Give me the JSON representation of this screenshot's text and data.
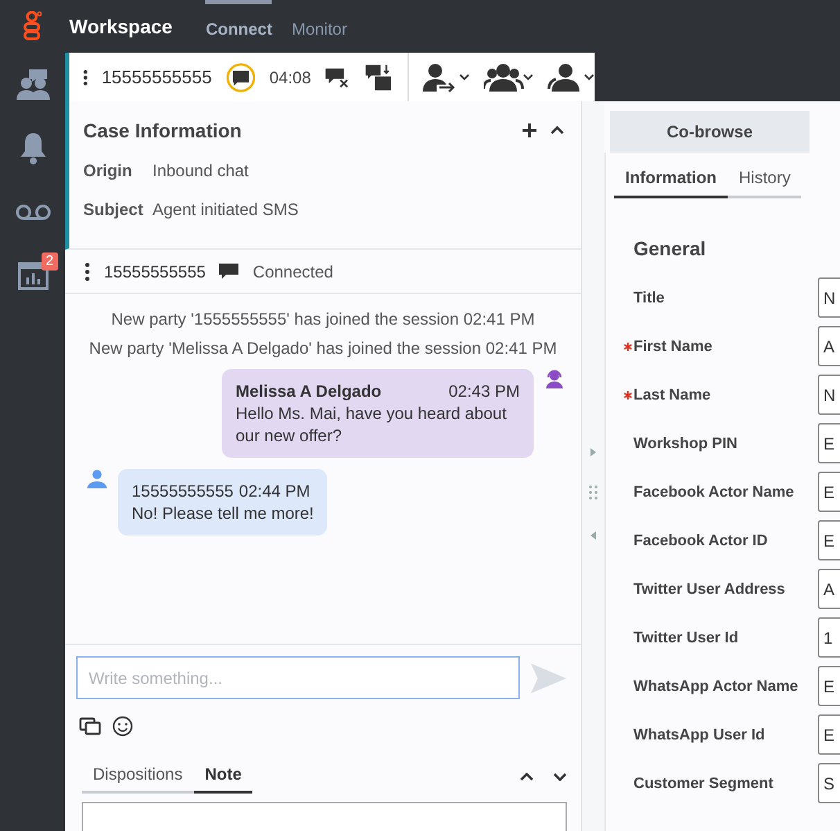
{
  "app": {
    "title": "Workspace"
  },
  "nav_tabs": [
    {
      "label": "Connect",
      "selected": true
    },
    {
      "label": "Monitor",
      "selected": false
    }
  ],
  "sidebar": [
    {
      "kind": "contacts"
    },
    {
      "kind": "notifications"
    },
    {
      "kind": "voicemail"
    },
    {
      "kind": "reports",
      "badge": "2"
    }
  ],
  "interaction_bar": {
    "phone": "15555555555",
    "timer": "04:08"
  },
  "case_information": {
    "title": "Case Information",
    "expanded": true,
    "fields": [
      {
        "label": "Origin",
        "value": "Inbound chat"
      },
      {
        "label": "Subject",
        "value": "Agent initiated SMS"
      }
    ]
  },
  "chat": {
    "party": "15555555555",
    "status": "Connected",
    "messages": [
      {
        "kind": "system",
        "text": "New party  '1555555555' has joined the session 02:41 PM"
      },
      {
        "kind": "system",
        "text": "New party 'Melissa A Delgado' has joined the session 02:41 PM"
      },
      {
        "kind": "agent",
        "sender": "Melissa A Delgado",
        "time": "02:43 PM",
        "text": "Hello Ms. Mai, have you heard about our new offer?"
      },
      {
        "kind": "customer",
        "sender": "15555555555",
        "time": "02:44 PM",
        "text": "No! Please tell me more!"
      }
    ],
    "placeholder": "Write something..."
  },
  "bottom_tabs": [
    {
      "label": "Dispositions",
      "selected": false
    },
    {
      "label": "Note",
      "selected": true
    }
  ],
  "right_panel": {
    "button": "Co-browse",
    "tabs": [
      {
        "label": "Information",
        "selected": true
      },
      {
        "label": "History",
        "selected": false
      }
    ],
    "section": "General",
    "fields": [
      {
        "label": "Title",
        "required": false,
        "value": "N"
      },
      {
        "label": "First Name",
        "required": true,
        "value": "A"
      },
      {
        "label": "Last Name",
        "required": true,
        "value": "N"
      },
      {
        "label": "Workshop PIN",
        "required": false,
        "value": "E"
      },
      {
        "label": "Facebook Actor Name",
        "required": false,
        "value": "E"
      },
      {
        "label": "Facebook Actor ID",
        "required": false,
        "value": "E"
      },
      {
        "label": "Twitter User Address",
        "required": false,
        "value": "A"
      },
      {
        "label": "Twitter User Id",
        "required": false,
        "value": "1"
      },
      {
        "label": "WhatsApp Actor Name",
        "required": false,
        "value": "E"
      },
      {
        "label": "WhatsApp User Id",
        "required": false,
        "value": "E"
      },
      {
        "label": "Customer Segment",
        "required": false,
        "value": "S"
      }
    ]
  }
}
